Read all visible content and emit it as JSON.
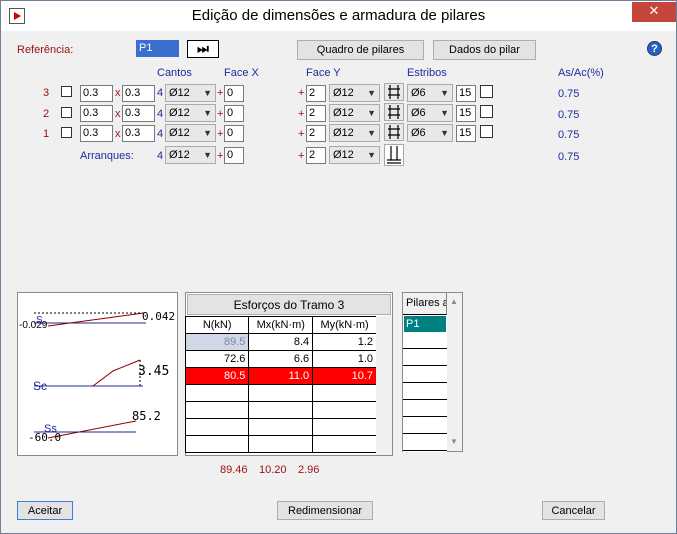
{
  "window": {
    "title": "Edição de dimensões e armadura de pilares",
    "close": "✕"
  },
  "referencia": {
    "label": "Referência:",
    "value": "P1",
    "next_glyph": "⏭"
  },
  "buttons": {
    "quadro": "Quadro de pilares",
    "dados": "Dados do pilar",
    "aceitar": "Aceitar",
    "redimensionar": "Redimensionar",
    "cancelar": "Cancelar"
  },
  "help_glyph": "?",
  "headers": {
    "cantos": "Cantos",
    "face_x": "Face X",
    "face_y": "Face Y",
    "estribos": "Estribos",
    "as_ac": "As/Ac(%)"
  },
  "rows": [
    {
      "num": "3",
      "dim_x": "0.3",
      "times": "x",
      "dim_y": "0.3",
      "cantos_n": "4",
      "cantos_d": "Ø12",
      "fx_plus": "+",
      "fx_n": "0",
      "fy_plus": "+",
      "fy_n": "2",
      "fy_d": "Ø12",
      "est_d": "Ø6",
      "est_s": "15",
      "as_ac": "0.75"
    },
    {
      "num": "2",
      "dim_x": "0.3",
      "times": "x",
      "dim_y": "0.3",
      "cantos_n": "4",
      "cantos_d": "Ø12",
      "fx_plus": "+",
      "fx_n": "0",
      "fy_plus": "+",
      "fy_n": "2",
      "fy_d": "Ø12",
      "est_d": "Ø6",
      "est_s": "15",
      "as_ac": "0.75"
    },
    {
      "num": "1",
      "dim_x": "0.3",
      "times": "x",
      "dim_y": "0.3",
      "cantos_n": "4",
      "cantos_d": "Ø12",
      "fx_plus": "+",
      "fx_n": "0",
      "fy_plus": "+",
      "fy_n": "2",
      "fy_d": "Ø12",
      "est_d": "Ø6",
      "est_s": "15",
      "as_ac": "0.75"
    }
  ],
  "arranques": {
    "label": "Arranques:",
    "cantos_n": "4",
    "cantos_d": "Ø12",
    "fx_plus": "+",
    "fx_n": "0",
    "fy_plus": "+",
    "fy_n": "2",
    "fy_d": "Ø12",
    "as_ac": "0.75"
  },
  "diagram": {
    "top": {
      "left": "-0.029",
      "right": "0.042",
      "label": "S"
    },
    "mid": {
      "value": "3.45",
      "label": "Sc"
    },
    "bot": {
      "left": "-60.0",
      "right": "85.2",
      "label": "Ss"
    }
  },
  "esforcos": {
    "title": "Esforços do Tramo 3",
    "columns": [
      "N(kN)",
      "Mx(kN·m)",
      "My(kN·m)"
    ],
    "rows": [
      [
        "89.5",
        "8.4",
        "1.2"
      ],
      [
        "72.6",
        "6.6",
        "1.0"
      ],
      [
        "80.5",
        "11.0",
        "10.7"
      ]
    ],
    "highlight_row": 2,
    "totals": [
      "89.46",
      "10.20",
      "2.96"
    ]
  },
  "pilares": {
    "header": "Pilares a",
    "items": [
      "P1"
    ]
  },
  "colors": {
    "red_label": "#9a1010",
    "blue_label": "#1f2a9a",
    "highlight": "#ff0000",
    "selected": "#008080"
  }
}
